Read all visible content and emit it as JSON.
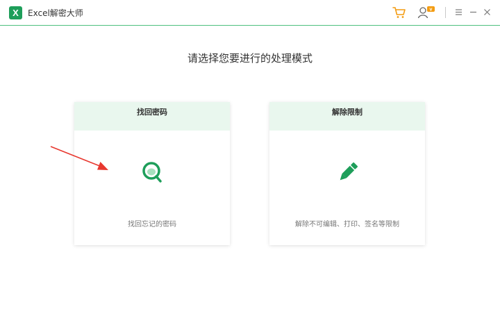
{
  "app": {
    "logo_letter": "X",
    "title": "Excel解密大师"
  },
  "titlebar": {
    "icons": [
      "cart-icon",
      "user-icon",
      "menu-icon",
      "minimize-icon",
      "close-icon"
    ],
    "accent_color": "#4cbf7d",
    "user_badge": "v"
  },
  "main": {
    "heading": "请选择您要进行的处理模式",
    "cards": [
      {
        "title": "找回密码",
        "description": "找回忘记的密码",
        "icon": "search-icon"
      },
      {
        "title": "解除限制",
        "description": "解除不可编辑、打印、签名等限制",
        "icon": "pencil-icon"
      }
    ]
  },
  "annotation": {
    "icon": "red-arrow-icon",
    "color": "#e8382f"
  }
}
